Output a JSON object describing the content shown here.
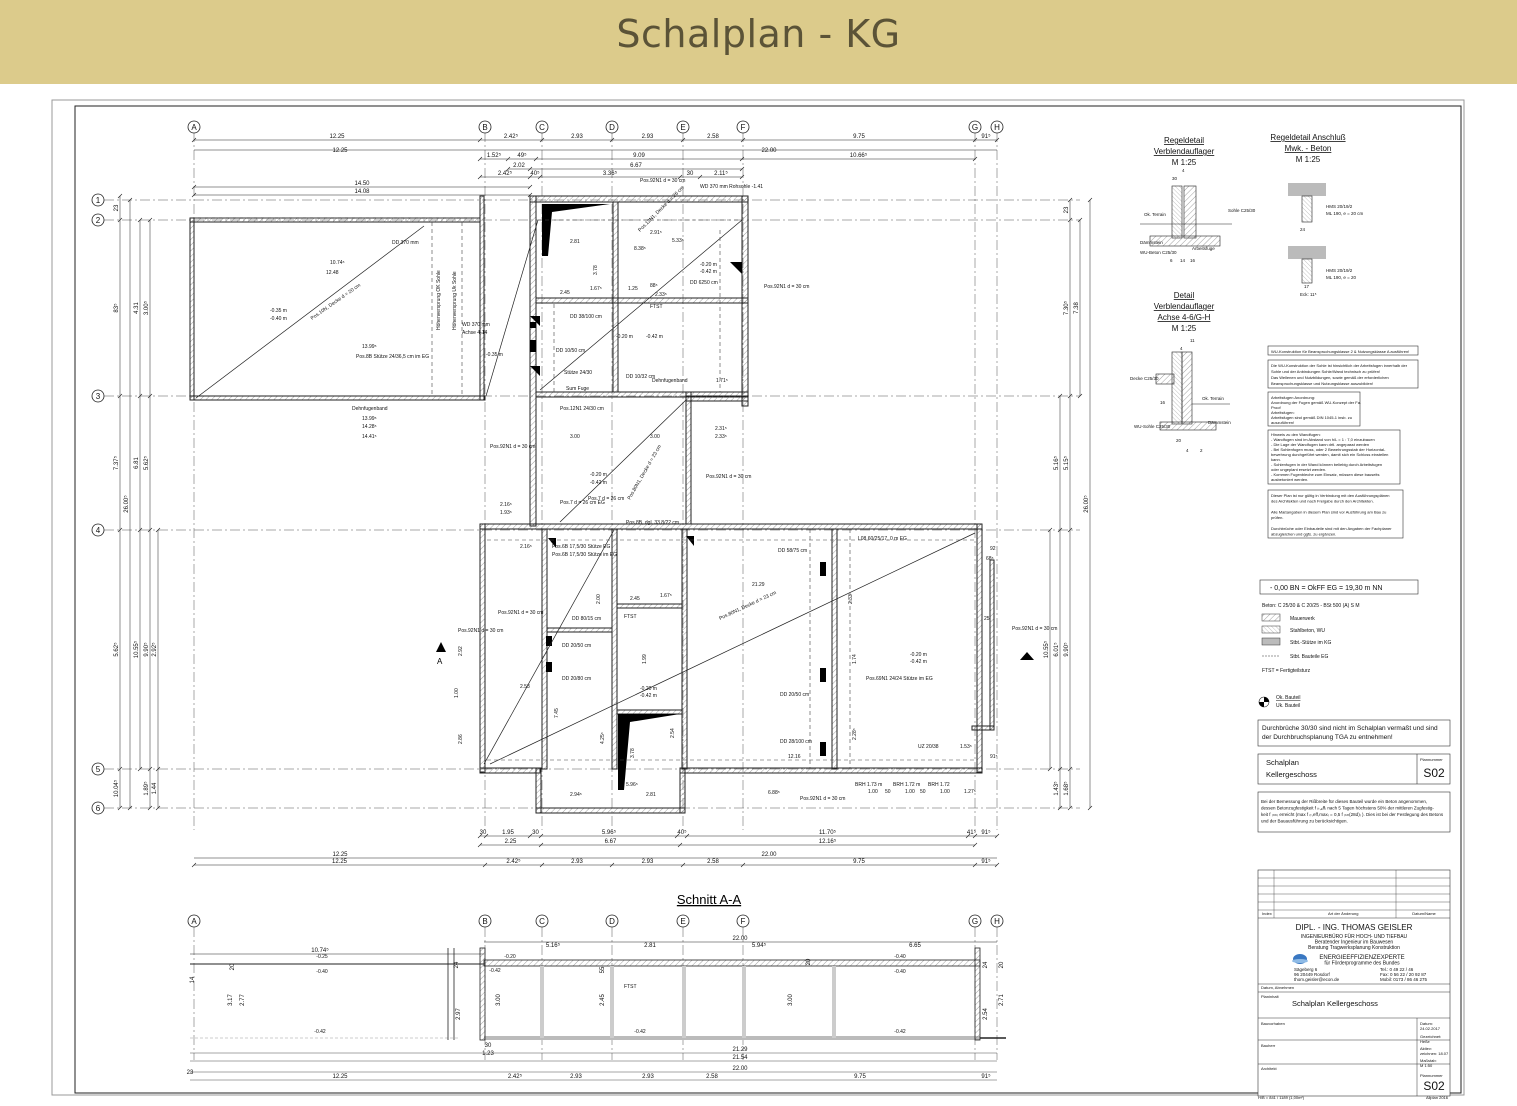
{
  "banner": {
    "title": "Schalplan - KG"
  },
  "axes": {
    "vertical": [
      "A",
      "B",
      "C",
      "D",
      "E",
      "F",
      "G",
      "H"
    ],
    "horizontal": [
      "1",
      "2",
      "3",
      "4",
      "5",
      "6"
    ]
  },
  "dims_top": {
    "row1": [
      "12.25",
      "2.42⁵",
      "2.93",
      "2.93",
      "2.58",
      "9.75",
      "91⁵"
    ],
    "row2_total": "22.00",
    "row2_left": "12.25",
    "row3": [
      "1.52⁵",
      "49⁵",
      "9.09",
      "10.66⁵"
    ],
    "row4": [
      "2.02",
      "6.67"
    ],
    "row5": [
      "2.42⁵",
      "40⁵",
      "3.36⁵",
      "30",
      "2.11⁵"
    ],
    "row6": [
      "14.50",
      "14.08"
    ]
  },
  "dims_bottom": {
    "row1": [
      "30",
      "1.95",
      "30",
      "5.96⁵",
      "40⁵",
      "11.70⁵",
      "41⁵",
      "91⁵"
    ],
    "row2": [
      "2.25",
      "6.67",
      "12.16⁵"
    ],
    "row3": [
      "12.25",
      "22.00"
    ],
    "row4": [
      "2.42⁵",
      "2.93",
      "2.93",
      "2.58",
      "9.75",
      "91⁵"
    ]
  },
  "dims_left": [
    "23",
    "83⁵",
    "4.31",
    "7.37⁵",
    "3.00⁵",
    "26.00⁵",
    "6.81",
    "5.62⁵",
    "2.92⁵",
    "10.04⁵",
    "10.55⁵",
    "9.90⁵",
    "1.89⁵",
    "1.44",
    "1.29"
  ],
  "dims_right": [
    "7.30⁵",
    "7.38",
    "5.16⁵",
    "5.15⁵",
    "26.00⁵",
    "5.62⁵",
    "1.53⁵",
    "6.01⁵",
    "9.90⁵",
    "10.55⁵",
    "10.04⁵",
    "1.83⁵",
    "1.43⁵",
    "1.68⁵"
  ],
  "plan_labels": {
    "left_room": [
      "DD 370 mm",
      "-0.35 m",
      "-0.40 m",
      "Pos.10N, Decke d = 20 cm",
      "10.74⁵",
      "12.48",
      "13.99⁵",
      "Höhenversprung OK Sohle",
      "Höhenversprung Uk Sohle",
      "WD 370 mm",
      "Achse 4-14",
      "-0.35 m",
      "Pos.8B Stütze 24/36,5 cm im EG",
      "Dehnfugenband",
      "13.99⁵",
      "14.28⁵",
      "14.41⁵"
    ],
    "top_center": [
      "Pos.92N1 d = 30 cm",
      "WD 370 mm Rohsohle -1.41",
      "2.81",
      "3.78",
      "2.91⁵",
      "5.33⁵",
      "8.38⁵",
      "Pos.12N1, Decke d = 26 cm",
      "-0.20 m",
      "-0.42 m",
      "Pos.92N1 d = 30 cm",
      "DD 6250 cm",
      "2.45",
      "1.67⁵",
      "1.25",
      "88⁵",
      "2.33⁵",
      "FTST",
      "DD 38/100 cm",
      "Stütze 24/30",
      "-0.20 m",
      "-0.42 m",
      "DD 10/50 cm",
      "Pos.12N1 24/30 cm",
      "DD 10/32 cm",
      "Sum Fuge",
      "Dehnfugenband",
      "1.71⁵",
      "2.31⁵",
      "2.33⁵",
      "3.00",
      "3.00",
      "Pos.92N1 d = 30 cm",
      "-0.20 m",
      "-0.42 m",
      "Pos.7 d = 26 cm",
      "Pos.80N1, Decke d = 23 cm",
      "Pos.92N1 d = 30 cm",
      "Pos.7 d = 26 cm EG",
      "2.16⁵",
      "1.93⁵",
      "Pos.8B, dgl. 33,8/22 cm"
    ],
    "bottom": [
      "2.16⁵",
      "Pos.6B 17,5/30 Stütze EG",
      "Pos.6B 17,5/30 Stütze im EG",
      "DD 58/75 cm",
      "L08 60/25/17, 0 m EG",
      "21.29",
      "DD 80/15 cm",
      "DD 20/50 cm",
      "DD 20/80 cm",
      "FTST",
      "2.45",
      "1.67⁵",
      "-0.20 m",
      "-0.42 m",
      "-0.20 m",
      "-0.42 m",
      "Pos.80N1, Decke d = 23 cm",
      "Pos.92N1 d = 30 cm",
      "DD 20/50 cm",
      "DD 28/100 cm",
      "12.16",
      "2.94⁵",
      "5.96⁵",
      "2.81",
      "6.88⁵",
      "Pos.92N1 d = 30 cm",
      "BRH 1.73 m",
      "BRH 1.72 m",
      "BRH 1.72",
      "1.00",
      "50",
      "1.00",
      "50",
      "1.00",
      "1.27⁵",
      "UZ 20/38",
      "2.53",
      "2.00",
      "2.33",
      "1.74",
      "1.99",
      "2.28⁵",
      "2.54",
      "3.78",
      "4.25⁵",
      "7.45",
      "2.86",
      "1.00",
      "2.92",
      "Pos.92N1 d = 30 cm",
      "Pos.92N1 d = 30 cm",
      "Pos.69N1 24/24 Stütze im EG",
      "92",
      "68⁵",
      "91⁵",
      "25",
      "1.53⁵"
    ]
  },
  "section": {
    "title": "Schnitt A-A",
    "dims_top": [
      "10.74⁵",
      "5.16⁵",
      "2.81",
      "5.94⁵",
      "6.65",
      "22.00"
    ],
    "levels": [
      "-0.25",
      "-0.40",
      "-0.42",
      "-0.20",
      "-0.42",
      "-0.42",
      "-0.40",
      "-0.40",
      "-0.42"
    ],
    "dims_vert": [
      "3.17",
      "2.77",
      "2.97",
      "3.00",
      "2.45",
      "3.00",
      "2.54",
      "2.71",
      "14",
      "20",
      "24",
      "55",
      "20",
      "24",
      "20"
    ],
    "dims_bottom": [
      "21.29",
      "21.54",
      "1.23",
      "30",
      "12.25",
      "22.00",
      "2.42⁵",
      "2.93",
      "2.93",
      "2.58",
      "9.75",
      "91⁵",
      "23"
    ],
    "labels": [
      "FTST"
    ]
  },
  "details": {
    "regeldetail1": [
      "Regeldetail",
      "Verblendauflager",
      "M 1:25"
    ],
    "regeldetail1_labels": [
      "Ok. Terrain",
      "Dämmstein",
      "Sohle C25/30",
      "WU-Beton C25/30",
      "Arbeitsfuge",
      "4",
      "30",
      "6",
      "14",
      "16"
    ],
    "regeldetail2": [
      "Regeldetail Anschluß",
      "Mwk. - Beton",
      "M 1:25"
    ],
    "regeldetail2_labels": [
      "HMS 20/19/2",
      "ML 190, e = 20 cm",
      "24",
      "HMS 20/19/2",
      "ML 190, e = 20",
      "17",
      "Eck: 11⁵"
    ],
    "detail3": [
      "Detail",
      "Verblendauflager",
      "Achse 4-6/G-H",
      "M 1:25"
    ],
    "detail3_labels": [
      "Decke C25/30",
      "Ok. Terrain",
      "WU-Sohle C25/30",
      "Dämmstein",
      "20",
      "4",
      "11",
      "4",
      "16",
      "2"
    ]
  },
  "notes": {
    "header": "WU-Konstruktion für Beanspruchungsklasse 2 & Nutzungsklasse A ausführen!",
    "note1": [
      "Die WU-Konstruktion der Sohle ist hinsichtlich der Arbeitsfugen innerhalb der",
      "Sohle und der Anbindungen Sohle/Wand technisch zu prüfen!",
      "Das Wellenen und Nutzbildungen, sowie gemäß der erforderlichen",
      "Beanspruchungsklasse und Nutzungsklasse auszubilden!"
    ],
    "note2": [
      "Arbeitsfugen Anordnung:",
      "Anordnung der Fugen gemäß WU-Konzept der Fa.",
      "Proof",
      "Arbeitsfugen:",
      "Arbeitsfugen sind gemäß DIN 1045-1 insb. zu",
      "auszuführen!"
    ],
    "note3": [
      "Hinweis zu den Wandfugen:",
      "- Wandfugen sind im Abstand von h/L = 1 : 7,0 einzubauen",
      "- Die Lage der Wandfugen kann drtl. angepasst werden",
      "- Bei Sohlenfugen muss, oder 2 Bewehrungsstab der Horizontal-",
      "  bewehrung durchgeführt werden, damit sich ein Schloss einstellen",
      "  kann.",
      "- Sohlenfugen in der Wand können beliebig durch Arbeitsfugen",
      "  oder ungeplant ersetzt werden.",
      "- Kommen Fugenbleche zum Einsatz, müssen diese bauseits",
      "  ausbetoniert werden."
    ],
    "note4": [
      "Dieser Plan ist nur gültig in Verbindung mit den Ausführungsplänen",
      "des Architekten und nach Freigabe durch den Architekten.",
      "",
      "Alle Maßangaben in diesem Plan sind vor Ausführung am Bau zu",
      "prüfen.",
      "",
      "Durchbrüche oder Einbauteile sind mit den Angaben der Fachplaner",
      "abzugleichen und ggfs. zu ergänzen."
    ]
  },
  "legend": {
    "level": "- 0,00 BN  =  OkFF EG  =     19,30 m NN",
    "beton": "Beton: C 25/30  & C 20/25 - BSt 500 (A) S  M",
    "items": [
      "Mauerwerk",
      "Stahlbeton, WU",
      "Stbt.-Stütze im KG",
      "Stbt. Bauteile EG"
    ],
    "ftst": "FTST = Fertigteilsturz",
    "marker_top": "Ok. Bauteil",
    "marker_bottom": "Uk. Bauteil",
    "durchbruch": [
      "Durchbrüche    30/30 sind nicht im Schalplan vermaßt und sind",
      "der Durchbruchsplanung TGA zu entnehmen!"
    ]
  },
  "titleblock": {
    "plan_label": "Schalplan",
    "plan_sub": "Kellergeschoss",
    "plannr_label": "Plannummer",
    "plannr": "S02",
    "note": [
      "Bei der Bemessung der Rißbreite für dieses Bauteil wurde ein Beton angenommen,",
      "dessen Betonzugfestigkeit f       ₍ₜ,ₑff₎ nach 5 Tagen höchstens 50% der mittleren Zugfestig-",
      "keit f ₍ₜₘ₎ erreicht (max f  ₍ₜ,eff,max₎ = 0,5 f ₍ₜₘ(28d)₎ ). Dies ist bei der Festlegung des Betons",
      "und der Bauausführung zu berücksichtigen."
    ],
    "index_headers": [
      "Index",
      "Art der Änderung",
      "Datum/Name"
    ],
    "firm": "DIPL. - ING. THOMAS  GEISLER",
    "firm_lines": [
      "INGENIEURBÜRO  FÜR  HOCH-  UND  TIEFBAU",
      "Beratender  Ingenieur  im  Bauwesen",
      "Beratung       Tragwerksplanung       Konstruktion"
    ],
    "eee": [
      "ENERGIEEFFIZIENZEXPERTE",
      "für  Förderprogramme  des  Bundes"
    ],
    "address": [
      "Sägeberg 6",
      "96 20449 Rosdorf",
      "thom.geisler@econ.de"
    ],
    "contact": [
      "Tel.: 0 49 22 / 46",
      "Fax: 0 56 22 / 20 92 87",
      "Mobil: 0173 / 86 46 275"
    ],
    "labels": [
      "Datum, Abnehmen",
      "Planinhalt",
      "Bauvorhaben",
      "Bauherr",
      "Architekt",
      "Plannummer"
    ],
    "planinhalt": "Schalplan Kellergeschoss",
    "meta": [
      "Datum:",
      "24.02.2017",
      "Gezeichnet:",
      "Heße",
      "Aktiev:",
      "zeichnen: 18.07",
      "Maßstab:",
      "M 1:50"
    ],
    "plannr2": "S02",
    "footer_left": "H/B = 841 / 1189 (1,00m²)",
    "footer_right": "Allplan 2016"
  }
}
